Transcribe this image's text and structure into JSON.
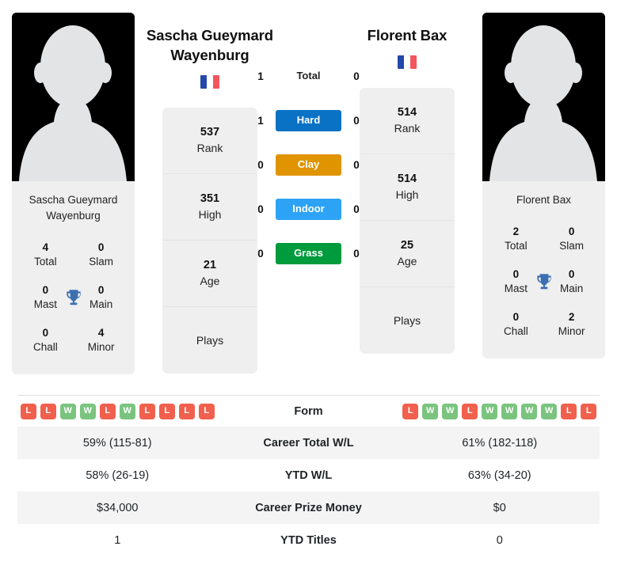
{
  "players": {
    "left": {
      "name": "Sascha Gueymard Wayenburg",
      "card_name": "Sascha Gueymard Wayenburg",
      "flag": "france-flag",
      "titles": {
        "total_value": "4",
        "total_label": "Total",
        "slam_value": "0",
        "slam_label": "Slam",
        "mast_value": "0",
        "mast_label": "Mast",
        "main_value": "0",
        "main_label": "Main",
        "chall_value": "0",
        "chall_label": "Chall",
        "minor_value": "4",
        "minor_label": "Minor"
      },
      "info": [
        {
          "value": "537",
          "label": "Rank"
        },
        {
          "value": "351",
          "label": "High"
        },
        {
          "value": "21",
          "label": "Age"
        },
        {
          "value": "",
          "label": "Plays"
        }
      ],
      "form": [
        "L",
        "L",
        "W",
        "W",
        "L",
        "W",
        "L",
        "L",
        "L",
        "L"
      ]
    },
    "right": {
      "name": "Florent Bax",
      "card_name": "Florent Bax",
      "flag": "france-flag",
      "titles": {
        "total_value": "2",
        "total_label": "Total",
        "slam_value": "0",
        "slam_label": "Slam",
        "mast_value": "0",
        "mast_label": "Mast",
        "main_value": "0",
        "main_label": "Main",
        "chall_value": "0",
        "chall_label": "Chall",
        "minor_value": "2",
        "minor_label": "Minor"
      },
      "info": [
        {
          "value": "514",
          "label": "Rank"
        },
        {
          "value": "514",
          "label": "High"
        },
        {
          "value": "25",
          "label": "Age"
        },
        {
          "value": "",
          "label": "Plays"
        }
      ],
      "form": [
        "L",
        "W",
        "W",
        "L",
        "W",
        "W",
        "W",
        "W",
        "L",
        "L"
      ]
    }
  },
  "surfaces": [
    {
      "label": "Total",
      "left": "1",
      "right": "0",
      "color": "transparent",
      "text_color": "#222222"
    },
    {
      "label": "Hard",
      "left": "1",
      "right": "0",
      "color": "#0a72c4",
      "text_color": "#ffffff"
    },
    {
      "label": "Clay",
      "left": "0",
      "right": "0",
      "color": "#e09400",
      "text_color": "#ffffff"
    },
    {
      "label": "Indoor",
      "left": "0",
      "right": "0",
      "color": "#2da3f5",
      "text_color": "#ffffff"
    },
    {
      "label": "Grass",
      "left": "0",
      "right": "0",
      "color": "#009b3c",
      "text_color": "#ffffff"
    }
  ],
  "comparison": {
    "form_label": "Form",
    "rows": [
      {
        "label": "Career Total W/L",
        "left": "59% (115-81)",
        "right": "61% (182-118)"
      },
      {
        "label": "YTD W/L",
        "left": "58% (26-19)",
        "right": "63% (34-20)"
      },
      {
        "label": "Career Prize Money",
        "left": "$34,000",
        "right": "$0"
      },
      {
        "label": "YTD Titles",
        "left": "1",
        "right": "0"
      }
    ]
  },
  "colors": {
    "win": "#7ac47f",
    "loss": "#f0604d",
    "trophy": "#3b6fb0",
    "card_bg": "#efefef",
    "row_shade": "#f4f4f4"
  }
}
